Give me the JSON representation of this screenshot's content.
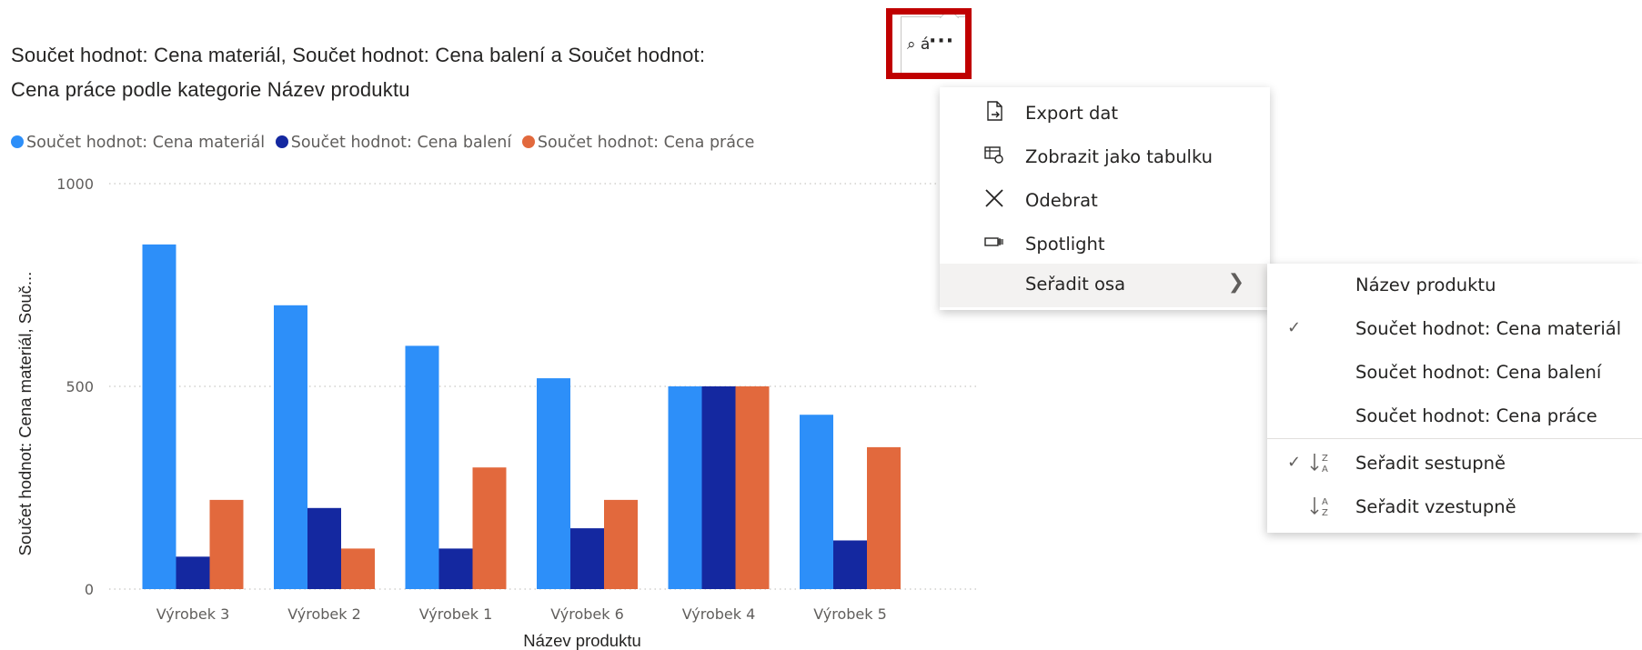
{
  "title": {
    "line1": "Součet hodnot: Cena materiál, Součet hodnot: Cena balení a Součet hodnot:",
    "line2": "Cena práce podle kategorie Název produktu"
  },
  "legend": [
    {
      "label": "Součet hodnot: Cena materiál",
      "color": "#2d8ff9"
    },
    {
      "label": "Součet hodnot: Cena balení",
      "color": "#1428a0"
    },
    {
      "label": "Součet hodnot: Cena práce",
      "color": "#e2693d"
    }
  ],
  "chart_data": {
    "type": "bar",
    "categories": [
      "Výrobek 3",
      "Výrobek 2",
      "Výrobek 1",
      "Výrobek 6",
      "Výrobek 4",
      "Výrobek 5"
    ],
    "series": [
      {
        "name": "Součet hodnot: Cena materiál",
        "color": "#2d8ff9",
        "values": [
          850,
          700,
          600,
          520,
          500,
          430
        ]
      },
      {
        "name": "Součet hodnot: Cena balení",
        "color": "#1428a0",
        "values": [
          80,
          200,
          100,
          150,
          500,
          120
        ]
      },
      {
        "name": "Součet hodnot: Cena práce",
        "color": "#e2693d",
        "values": [
          220,
          100,
          300,
          220,
          500,
          350
        ]
      }
    ],
    "ylabel": "Součet hodnot: Cena materiál, Souč...",
    "xlabel": "Název produktu",
    "ylim": [
      0,
      1000
    ],
    "yticks": [
      "0",
      "500",
      "1000"
    ],
    "grid": true
  },
  "visual_header": {
    "icon_glyph": "⌕ á",
    "more_label": "···"
  },
  "context_menu": {
    "items": [
      {
        "label": "Export dat",
        "icon": "export-icon"
      },
      {
        "label": "Zobrazit jako tabulku",
        "icon": "table-view-icon"
      },
      {
        "label": "Odebrat",
        "icon": "close-icon"
      },
      {
        "label": "Spotlight",
        "icon": "spotlight-icon"
      },
      {
        "label": "Seřadit osa",
        "icon": "",
        "has_submenu": true
      }
    ]
  },
  "sort_submenu": {
    "fields": [
      {
        "label": "Název produktu",
        "checked": false
      },
      {
        "label": "Součet hodnot: Cena materiál",
        "checked": true
      },
      {
        "label": "Součet hodnot: Cena balení",
        "checked": false
      },
      {
        "label": "Součet hodnot: Cena práce",
        "checked": false
      }
    ],
    "directions": [
      {
        "label": "Seřadit sestupně",
        "checked": true,
        "icon": "sort-descending-icon"
      },
      {
        "label": "Seřadit vzestupně",
        "checked": false,
        "icon": "sort-ascending-icon"
      }
    ],
    "check_glyph": "✓"
  }
}
